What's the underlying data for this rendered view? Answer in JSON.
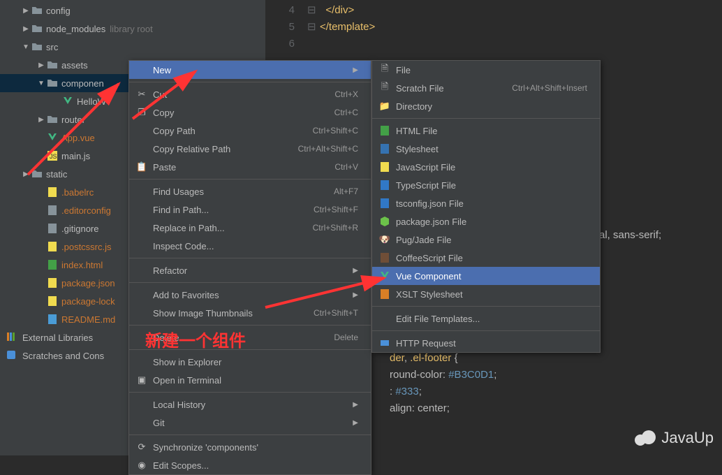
{
  "tree": {
    "config": "config",
    "node_modules": "node_modules",
    "node_modules_sub": "library root",
    "src": "src",
    "assets": "assets",
    "components": "componen",
    "hello": "HelloW",
    "router": "router",
    "app": "App.vue",
    "main": "main.js",
    "static": "static",
    "babelrc": ".babelrc",
    "editorconfig": ".editorconfig",
    "gitignore": ".gitignore",
    "postcss": ".postcssrc.js",
    "index": "index.html",
    "pkg": "package.json",
    "pkglock": "package-lock",
    "readme": "README.md",
    "extlib": "External Libraries",
    "scratches": "Scratches and Cons"
  },
  "editor": {
    "l4": "4",
    "l5": "5",
    "l6": "6",
    "code4": "</div>",
    "code5": "</template>",
    "sel_line": "der, .el-footer {",
    "bg_line": "round-color: #B3C0D1;",
    "color_line": ": #333;",
    "align_line": "align: center;",
    "family_line": "al, sans-serif;"
  },
  "menu1": {
    "new": "New",
    "cut": "Cut",
    "cut_sc": "Ctrl+X",
    "copy": "Copy",
    "copy_sc": "Ctrl+C",
    "copypath": "Copy Path",
    "copypath_sc": "Ctrl+Shift+C",
    "copyrel": "Copy Relative Path",
    "copyrel_sc": "Ctrl+Alt+Shift+C",
    "paste": "Paste",
    "paste_sc": "Ctrl+V",
    "findusages": "Find Usages",
    "findusages_sc": "Alt+F7",
    "findpath": "Find in Path...",
    "findpath_sc": "Ctrl+Shift+F",
    "replace": "Replace in Path...",
    "replace_sc": "Ctrl+Shift+R",
    "inspect": "Inspect Code...",
    "refactor": "Refactor",
    "favorites": "Add to Favorites",
    "thumbs": "Show Image Thumbnails",
    "thumbs_sc": "Ctrl+Shift+T",
    "delete": "Delete...",
    "delete_sc": "Delete",
    "explorer": "Show in Explorer",
    "terminal": "Open in Terminal",
    "localhist": "Local History",
    "git": "Git",
    "sync": "Synchronize 'components'",
    "scopes": "Edit Scopes..."
  },
  "menu2": {
    "file": "File",
    "scratch": "Scratch File",
    "scratch_sc": "Ctrl+Alt+Shift+Insert",
    "directory": "Directory",
    "html": "HTML File",
    "stylesheet": "Stylesheet",
    "js": "JavaScript File",
    "ts": "TypeScript File",
    "tsconfig": "tsconfig.json File",
    "pkgjson": "package.json File",
    "pug": "Pug/Jade File",
    "coffee": "CoffeeScript File",
    "vue": "Vue Component",
    "xslt": "XSLT Stylesheet",
    "tpl": "Edit File Templates...",
    "http": "HTTP Request"
  },
  "annotation": "新建一个组件",
  "watermark": "JavaUp"
}
